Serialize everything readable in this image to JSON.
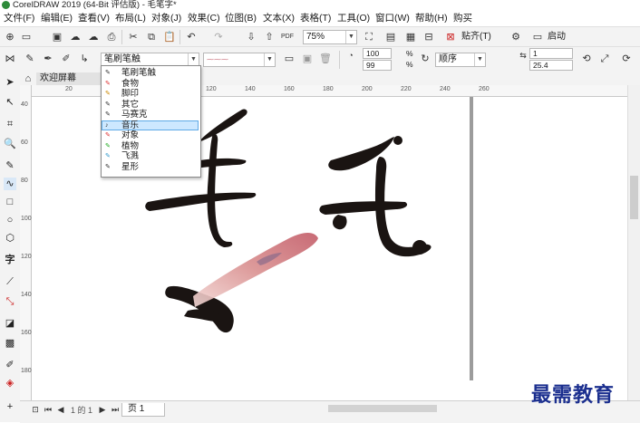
{
  "window": {
    "title": "CorelDRAW 2019 (64-Bit 评估版) - 毛笔字*"
  },
  "menu": [
    "文件(F)",
    "编辑(E)",
    "查看(V)",
    "布局(L)",
    "对象(J)",
    "效果(C)",
    "位图(B)",
    "文本(X)",
    "表格(T)",
    "工具(O)",
    "窗口(W)",
    "帮助(H)",
    "购买"
  ],
  "toolbar1": {
    "zoom": "75%",
    "paste_label": "贴齐(T)",
    "launch_label": "启动"
  },
  "toolbar2": {
    "brush_category": "笔刷笔触",
    "smoothing": "100",
    "size_value": "99",
    "percent": "%",
    "order_label": "顺序",
    "angle_value": "1",
    "width_value": "25.4"
  },
  "dropdown": {
    "items": [
      "笔刷笔触",
      "食物",
      "脚印",
      "其它",
      "马赛克",
      "音乐",
      "对象",
      "植物",
      "飞溅",
      "星形"
    ],
    "selected": "音乐"
  },
  "doc_tab": {
    "label": "欢迎屏幕"
  },
  "ruler": {
    "h_ticks": [
      "20",
      "40",
      "60",
      "80",
      "100",
      "120",
      "140",
      "160",
      "180",
      "200",
      "220",
      "240",
      "260"
    ],
    "v_ticks": [
      "40",
      "60",
      "80",
      "100",
      "120",
      "140",
      "160",
      "180"
    ]
  },
  "bottom": {
    "page_counter": "1 的 1",
    "page_tab": "页 1"
  },
  "watermark": "最需教育",
  "colors": {
    "accent": "#1b2f8f",
    "selection": "#cde8ff",
    "brush_pink": "#c96e7a"
  }
}
